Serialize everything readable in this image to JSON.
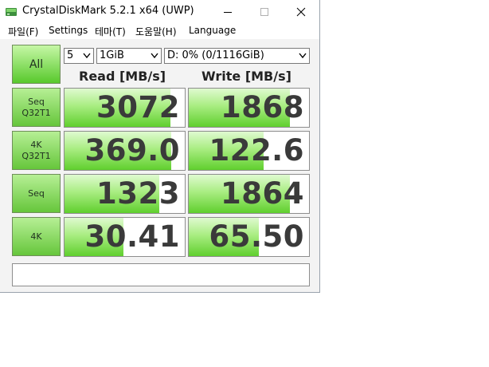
{
  "window": {
    "title": "CrystalDiskMark 5.2.1 x64 (UWP)"
  },
  "menu": [
    "파일(F)",
    "Settings",
    "테마(T)",
    "도움말(H)",
    "Language"
  ],
  "controls": {
    "all_button": "All",
    "count": "5",
    "size": "1GiB",
    "drive": "D: 0% (0/1116GiB)"
  },
  "headers": {
    "read": "Read [MB/s]",
    "write": "Write [MB/s]"
  },
  "rows": [
    {
      "label_line1": "Seq",
      "label_line2": "Q32T1",
      "read": "3072",
      "write": "1868",
      "read_fill_pct": 88,
      "write_fill_pct": 84
    },
    {
      "label_line1": "4K",
      "label_line2": "Q32T1",
      "read": "369.0",
      "write": "122.6",
      "read_fill_pct": 89,
      "write_fill_pct": 62
    },
    {
      "label_line1": "Seq",
      "label_line2": "",
      "read": "1323",
      "write": "1864",
      "read_fill_pct": 79,
      "write_fill_pct": 84
    },
    {
      "label_line1": "4K",
      "label_line2": "",
      "read": "30.41",
      "write": "65.50",
      "read_fill_pct": 49,
      "write_fill_pct": 58
    }
  ],
  "colors": {
    "button_green_top": "#c6f7a6",
    "button_green_bottom": "#58c92c",
    "bar_green": "#60cf2e",
    "value_text": "#3a3a3a",
    "client_bg": "#f3f3f3"
  },
  "icons": {
    "app": "crystaldiskmark-disk-icon",
    "minimize": "minimize-icon",
    "maximize": "maximize-icon",
    "close": "close-icon",
    "dropdown": "chevron-down-icon"
  }
}
